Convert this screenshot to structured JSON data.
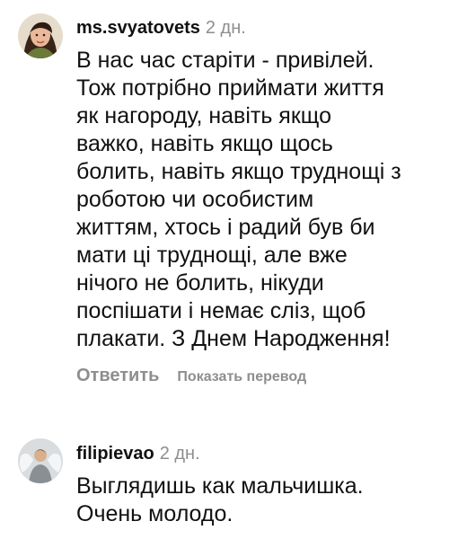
{
  "comments": [
    {
      "username": "ms.svyatovets",
      "time": "2 дн.",
      "avatar": "profile-photo-woman",
      "lines": [
        "В нас час старіти - привілей.",
        "Тож потрібно приймати життя",
        "як нагороду, навіть якщо",
        "важко, навіть якщо щось",
        "болить, навіть якщо труднощі з",
        "роботою чи особистим",
        "життям, хтось і радий був би",
        "мати ці труднощі, але вже",
        "нічого не болить, нікуди",
        "поспішати і немає сліз, щоб",
        "плакати. З Днем Народження!"
      ],
      "reply_label": "Ответить",
      "translate_label": "Показать перевод"
    },
    {
      "username": "filipievao",
      "time": "2 дн.",
      "avatar": "profile-photo-angel-wings",
      "lines": [
        "Выглядишь как мальчишка.",
        "Очень молодо."
      ]
    }
  ],
  "colors": {
    "text": "#111111",
    "muted": "#8e8e8e",
    "background": "#ffffff"
  }
}
